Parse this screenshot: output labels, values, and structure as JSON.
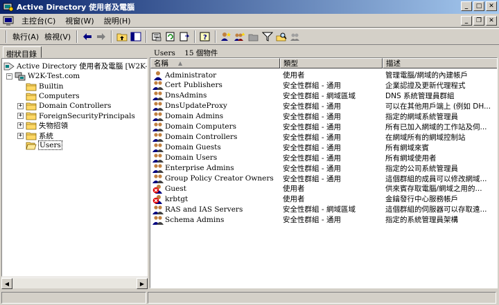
{
  "window": {
    "title": "Active Directory 使用者及電腦"
  },
  "menu": [
    {
      "label": "主控台(C)"
    },
    {
      "label": "視窗(W)"
    },
    {
      "label": "說明(H)"
    }
  ],
  "toolbar": {
    "action_label": "執行(A)",
    "view_label": "檢視(V)"
  },
  "left_pane": {
    "tab_label": "樹狀目錄",
    "root_label": "Active Directory 使用者及電腦 [W2K-doms",
    "domain_label": "W2K-Test.com",
    "items": [
      {
        "label": "Builtin",
        "expander": ""
      },
      {
        "label": "Computers",
        "expander": ""
      },
      {
        "label": "Domain Controllers",
        "expander": "+"
      },
      {
        "label": "ForeignSecurityPrincipals",
        "expander": "+"
      },
      {
        "label": "失物招領",
        "expander": "+"
      },
      {
        "label": "系統",
        "expander": "+"
      },
      {
        "label": "Users",
        "expander": ""
      }
    ]
  },
  "right_pane": {
    "header_folder": "Users",
    "header_count": "15 個物件",
    "columns": [
      "名稱",
      "類型",
      "描述"
    ],
    "rows": [
      {
        "name": "Administrator",
        "type": "使用者",
        "desc": "管理電腦/網域的內建帳戶",
        "icon": "user"
      },
      {
        "name": "Cert Publishers",
        "type": "安全性群組 - 通用",
        "desc": "企業認證及更新代理程式",
        "icon": "group"
      },
      {
        "name": "DnsAdmins",
        "type": "安全性群組 - 網域區域",
        "desc": "DNS 系統管理員群組",
        "icon": "group"
      },
      {
        "name": "DnsUpdateProxy",
        "type": "安全性群組 - 通用",
        "desc": "可以在其他用戶端上 (例如 DH...",
        "icon": "group"
      },
      {
        "name": "Domain Admins",
        "type": "安全性群組 - 通用",
        "desc": "指定的網域系統管理員",
        "icon": "group"
      },
      {
        "name": "Domain Computers",
        "type": "安全性群組 - 通用",
        "desc": "所有已加入網域的工作站及伺...",
        "icon": "group"
      },
      {
        "name": "Domain Controllers",
        "type": "安全性群組 - 通用",
        "desc": "在網域所有的網域控制站",
        "icon": "group"
      },
      {
        "name": "Domain Guests",
        "type": "安全性群組 - 通用",
        "desc": "所有網域來賓",
        "icon": "group"
      },
      {
        "name": "Domain Users",
        "type": "安全性群組 - 通用",
        "desc": "所有網域使用者",
        "icon": "group"
      },
      {
        "name": "Enterprise Admins",
        "type": "安全性群組 - 通用",
        "desc": "指定的公司系統管理員",
        "icon": "group"
      },
      {
        "name": "Group Policy Creator Owners",
        "type": "安全性群組 - 通用",
        "desc": "這個群組的成員可以修改網域...",
        "icon": "group"
      },
      {
        "name": "Guest",
        "type": "使用者",
        "desc": "供來賓存取電腦/網域之用的...",
        "icon": "user-disabled"
      },
      {
        "name": "krbtgt",
        "type": "使用者",
        "desc": "金鑰發行中心服務帳戶",
        "icon": "user-disabled"
      },
      {
        "name": "RAS and IAS Servers",
        "type": "安全性群組 - 網域區域",
        "desc": "這個群組的伺服器可以存取遠...",
        "icon": "group"
      },
      {
        "name": "Schema Admins",
        "type": "安全性群組 - 通用",
        "desc": "指定的系統管理員架構",
        "icon": "group"
      }
    ]
  },
  "colors": {
    "title_start": "#0a246a",
    "title_end": "#a6caf0",
    "face": "#d4d0c8"
  }
}
